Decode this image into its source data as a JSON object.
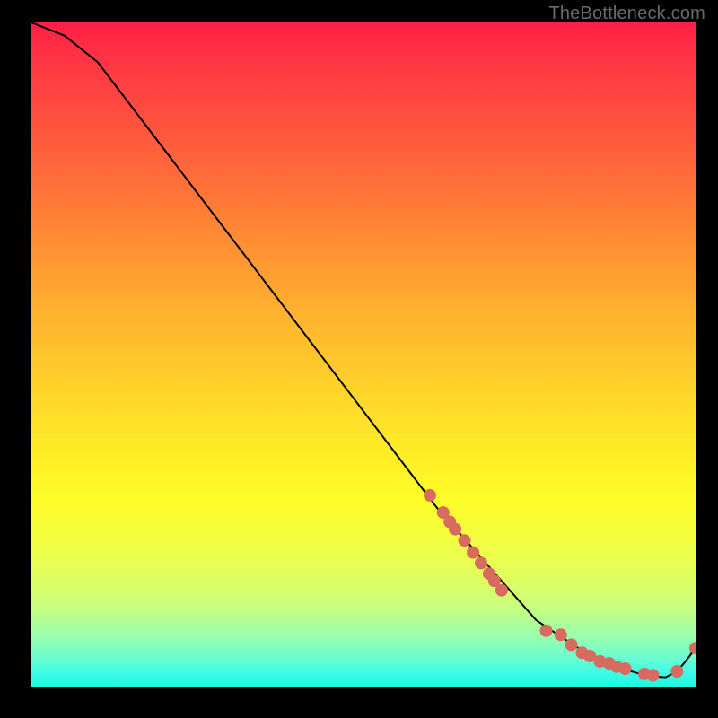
{
  "watermark": "TheBottleneck.com",
  "chart_data": {
    "type": "line",
    "title": "",
    "xlabel": "",
    "ylabel": "",
    "xlim": [
      0,
      100
    ],
    "ylim": [
      0,
      100
    ],
    "grid": false,
    "legend": false,
    "series": [
      {
        "name": "bottleneck-curve",
        "color": "#000000",
        "x": [
          0,
          5,
          10,
          61,
          76,
          79,
          82,
          85,
          88,
          90,
          92,
          94,
          95.5,
          97.2,
          98.5,
          100
        ],
        "values": [
          100,
          98,
          94,
          27,
          10,
          8,
          6,
          4.5,
          3.2,
          2.4,
          1.8,
          1.5,
          1.4,
          2.3,
          3.8,
          5.8
        ]
      }
    ],
    "markers": {
      "name": "highlight-points",
      "color": "#d86a5f",
      "radius_px": 7,
      "x": [
        60,
        62,
        63,
        63.8,
        65.2,
        66.5,
        67.7,
        68.9,
        69.7,
        70.8,
        77.5,
        79.7,
        81.3,
        82.9,
        84.1,
        85.6,
        87,
        88.1,
        89.4,
        92.3,
        93.6,
        97.2,
        100
      ],
      "values": [
        28.8,
        26.2,
        24.8,
        23.7,
        22.0,
        20.2,
        18.6,
        17.0,
        15.9,
        14.5,
        8.4,
        7.8,
        6.3,
        5.1,
        4.6,
        3.8,
        3.5,
        3.0,
        2.7,
        1.9,
        1.7,
        2.3,
        5.8
      ]
    },
    "background_gradient": {
      "direction": "top-to-bottom",
      "stops": [
        {
          "pos": 0,
          "color": "#ff1f47"
        },
        {
          "pos": 50,
          "color": "#ffd02c"
        },
        {
          "pos": 75,
          "color": "#fdfd2a"
        },
        {
          "pos": 100,
          "color": "#1ef9e1"
        }
      ]
    }
  }
}
